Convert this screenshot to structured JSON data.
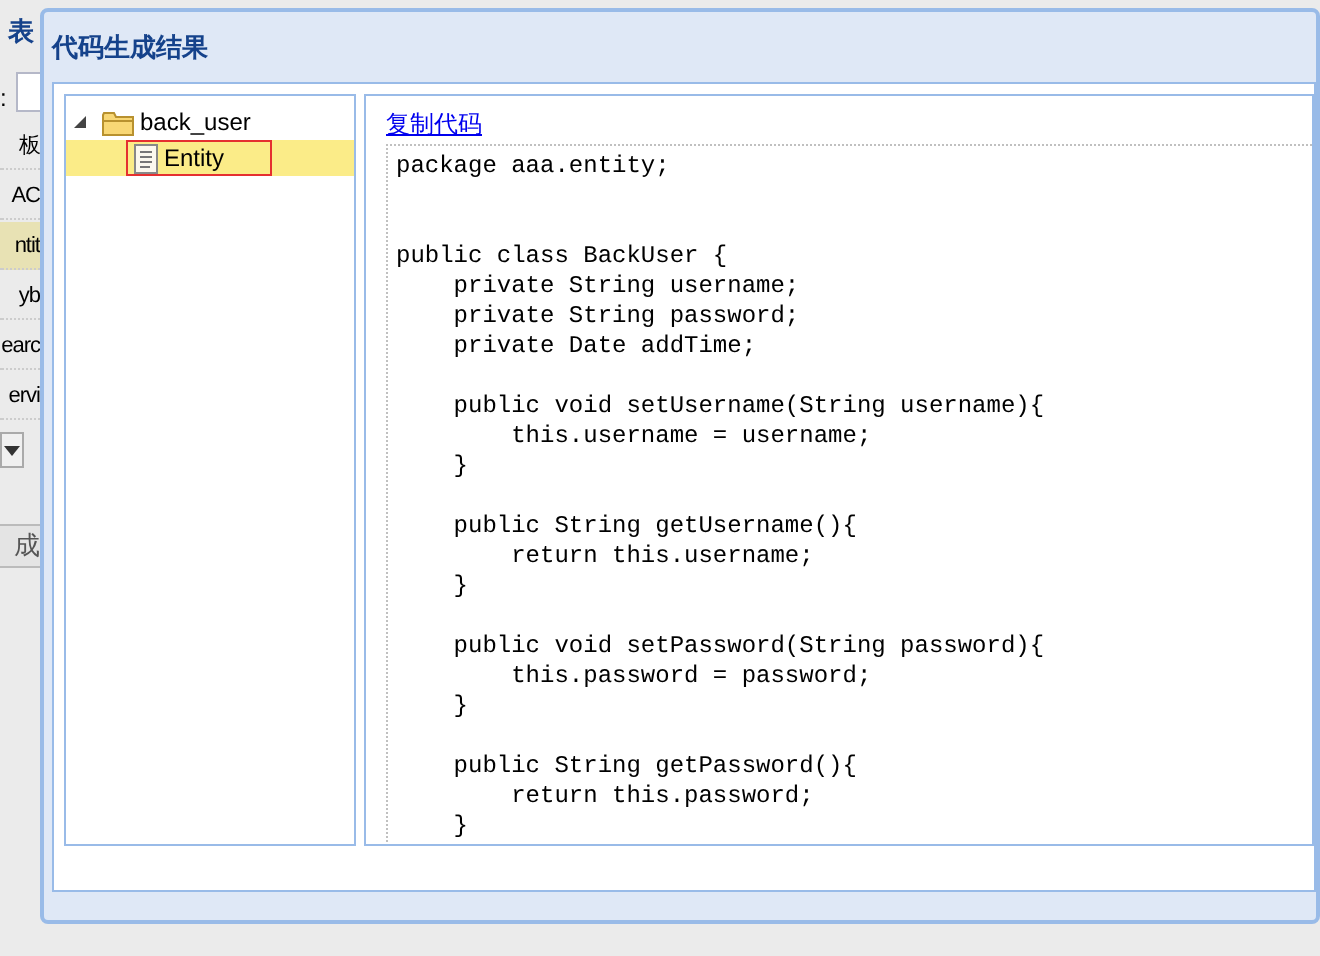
{
  "background": {
    "header": "表",
    "field_label": ":",
    "list_items": [
      {
        "label": "板",
        "selected": false
      },
      {
        "label": "AC",
        "selected": false
      },
      {
        "label": "ntit",
        "selected": true
      },
      {
        "label": "yb",
        "selected": false
      },
      {
        "label": "earc",
        "selected": false
      },
      {
        "label": "ervi",
        "selected": false
      }
    ],
    "button": "成"
  },
  "dialog": {
    "title": "代码生成结果",
    "tree": [
      {
        "label": "back_user",
        "expanded": true,
        "selected": false,
        "children": [
          {
            "label": "Entity",
            "selected": true,
            "focused": true
          }
        ]
      }
    ],
    "copy_link": "复制代码",
    "code": "package aaa.entity;\n\n\npublic class BackUser {\n    private String username;\n    private String password;\n    private Date addTime;\n\n    public void setUsername(String username){\n        this.username = username;\n    }\n\n    public String getUsername(){\n        return this.username;\n    }\n\n    public void setPassword(String password){\n        this.password = password;\n    }\n\n    public String getPassword(){\n        return this.password;\n    }"
  }
}
